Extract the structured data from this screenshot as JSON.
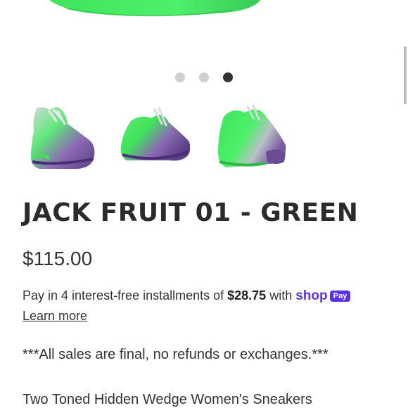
{
  "product": {
    "title": "JACK FRUIT 01 - GREEN",
    "price": "$115.00"
  },
  "gallery": {
    "dots_count": 3,
    "active_index": 2,
    "thumbnails": [
      "sneaker-side-view",
      "sneaker-front-angle",
      "sneaker-rear-angle"
    ],
    "colors": {
      "green": "#3fe45a",
      "purple": "#6a4c93",
      "lace": "#c8cbcf"
    }
  },
  "installments": {
    "prefix": "Pay in 4 interest-free installments of ",
    "amount": "$28.75",
    "suffix": " with ",
    "brand": "shop",
    "badge": "Pay",
    "brand_color": "#5a31f4",
    "learn_more": "Learn more"
  },
  "notice": "***All sales are final, no refunds or exchanges.***",
  "description": "Two Toned Hidden Wedge Women's Sneakers"
}
